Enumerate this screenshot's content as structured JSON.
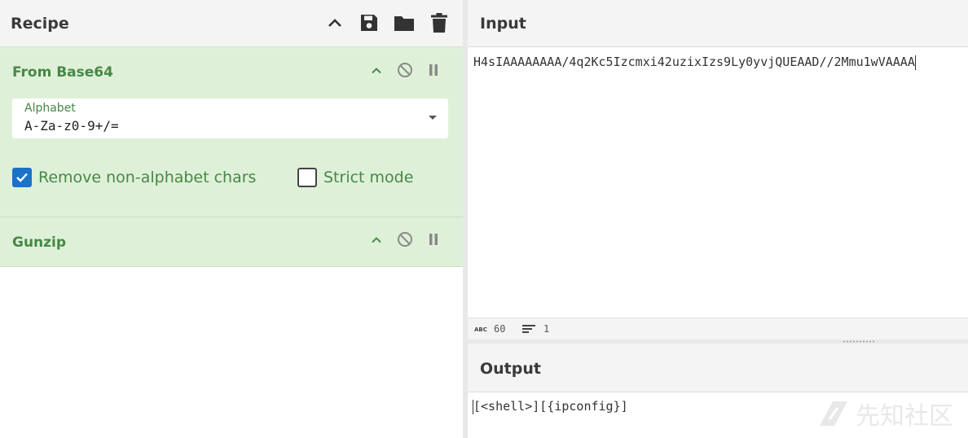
{
  "recipe": {
    "title": "Recipe",
    "icons": [
      "chevron-up-icon",
      "save-icon",
      "folder-icon",
      "trash-icon"
    ]
  },
  "operations": [
    {
      "name": "From Base64",
      "args": {
        "alphabet_label": "Alphabet",
        "alphabet_value": "A-Za-z0-9+/=",
        "remove_non_alphabet_label": "Remove non-alphabet chars",
        "remove_non_alphabet_checked": true,
        "strict_mode_label": "Strict mode",
        "strict_mode_checked": false
      }
    },
    {
      "name": "Gunzip"
    }
  ],
  "input": {
    "title": "Input",
    "text": "H4sIAAAAAAAA/4q2Kc5Izcmxi42uzixIzs9Ly0yvjQUEAAD//2Mmu1wVAAAA",
    "status": {
      "length": "60",
      "lines": "1"
    }
  },
  "output": {
    "title": "Output",
    "text": "[<shell>][{ipconfig}]"
  },
  "watermark": {
    "text": "先知社区"
  },
  "colors": {
    "op_background": "#dff0d8",
    "op_text": "#468847",
    "checkbox_checked": "#1a73c8",
    "header_background": "#f4f4f4"
  }
}
